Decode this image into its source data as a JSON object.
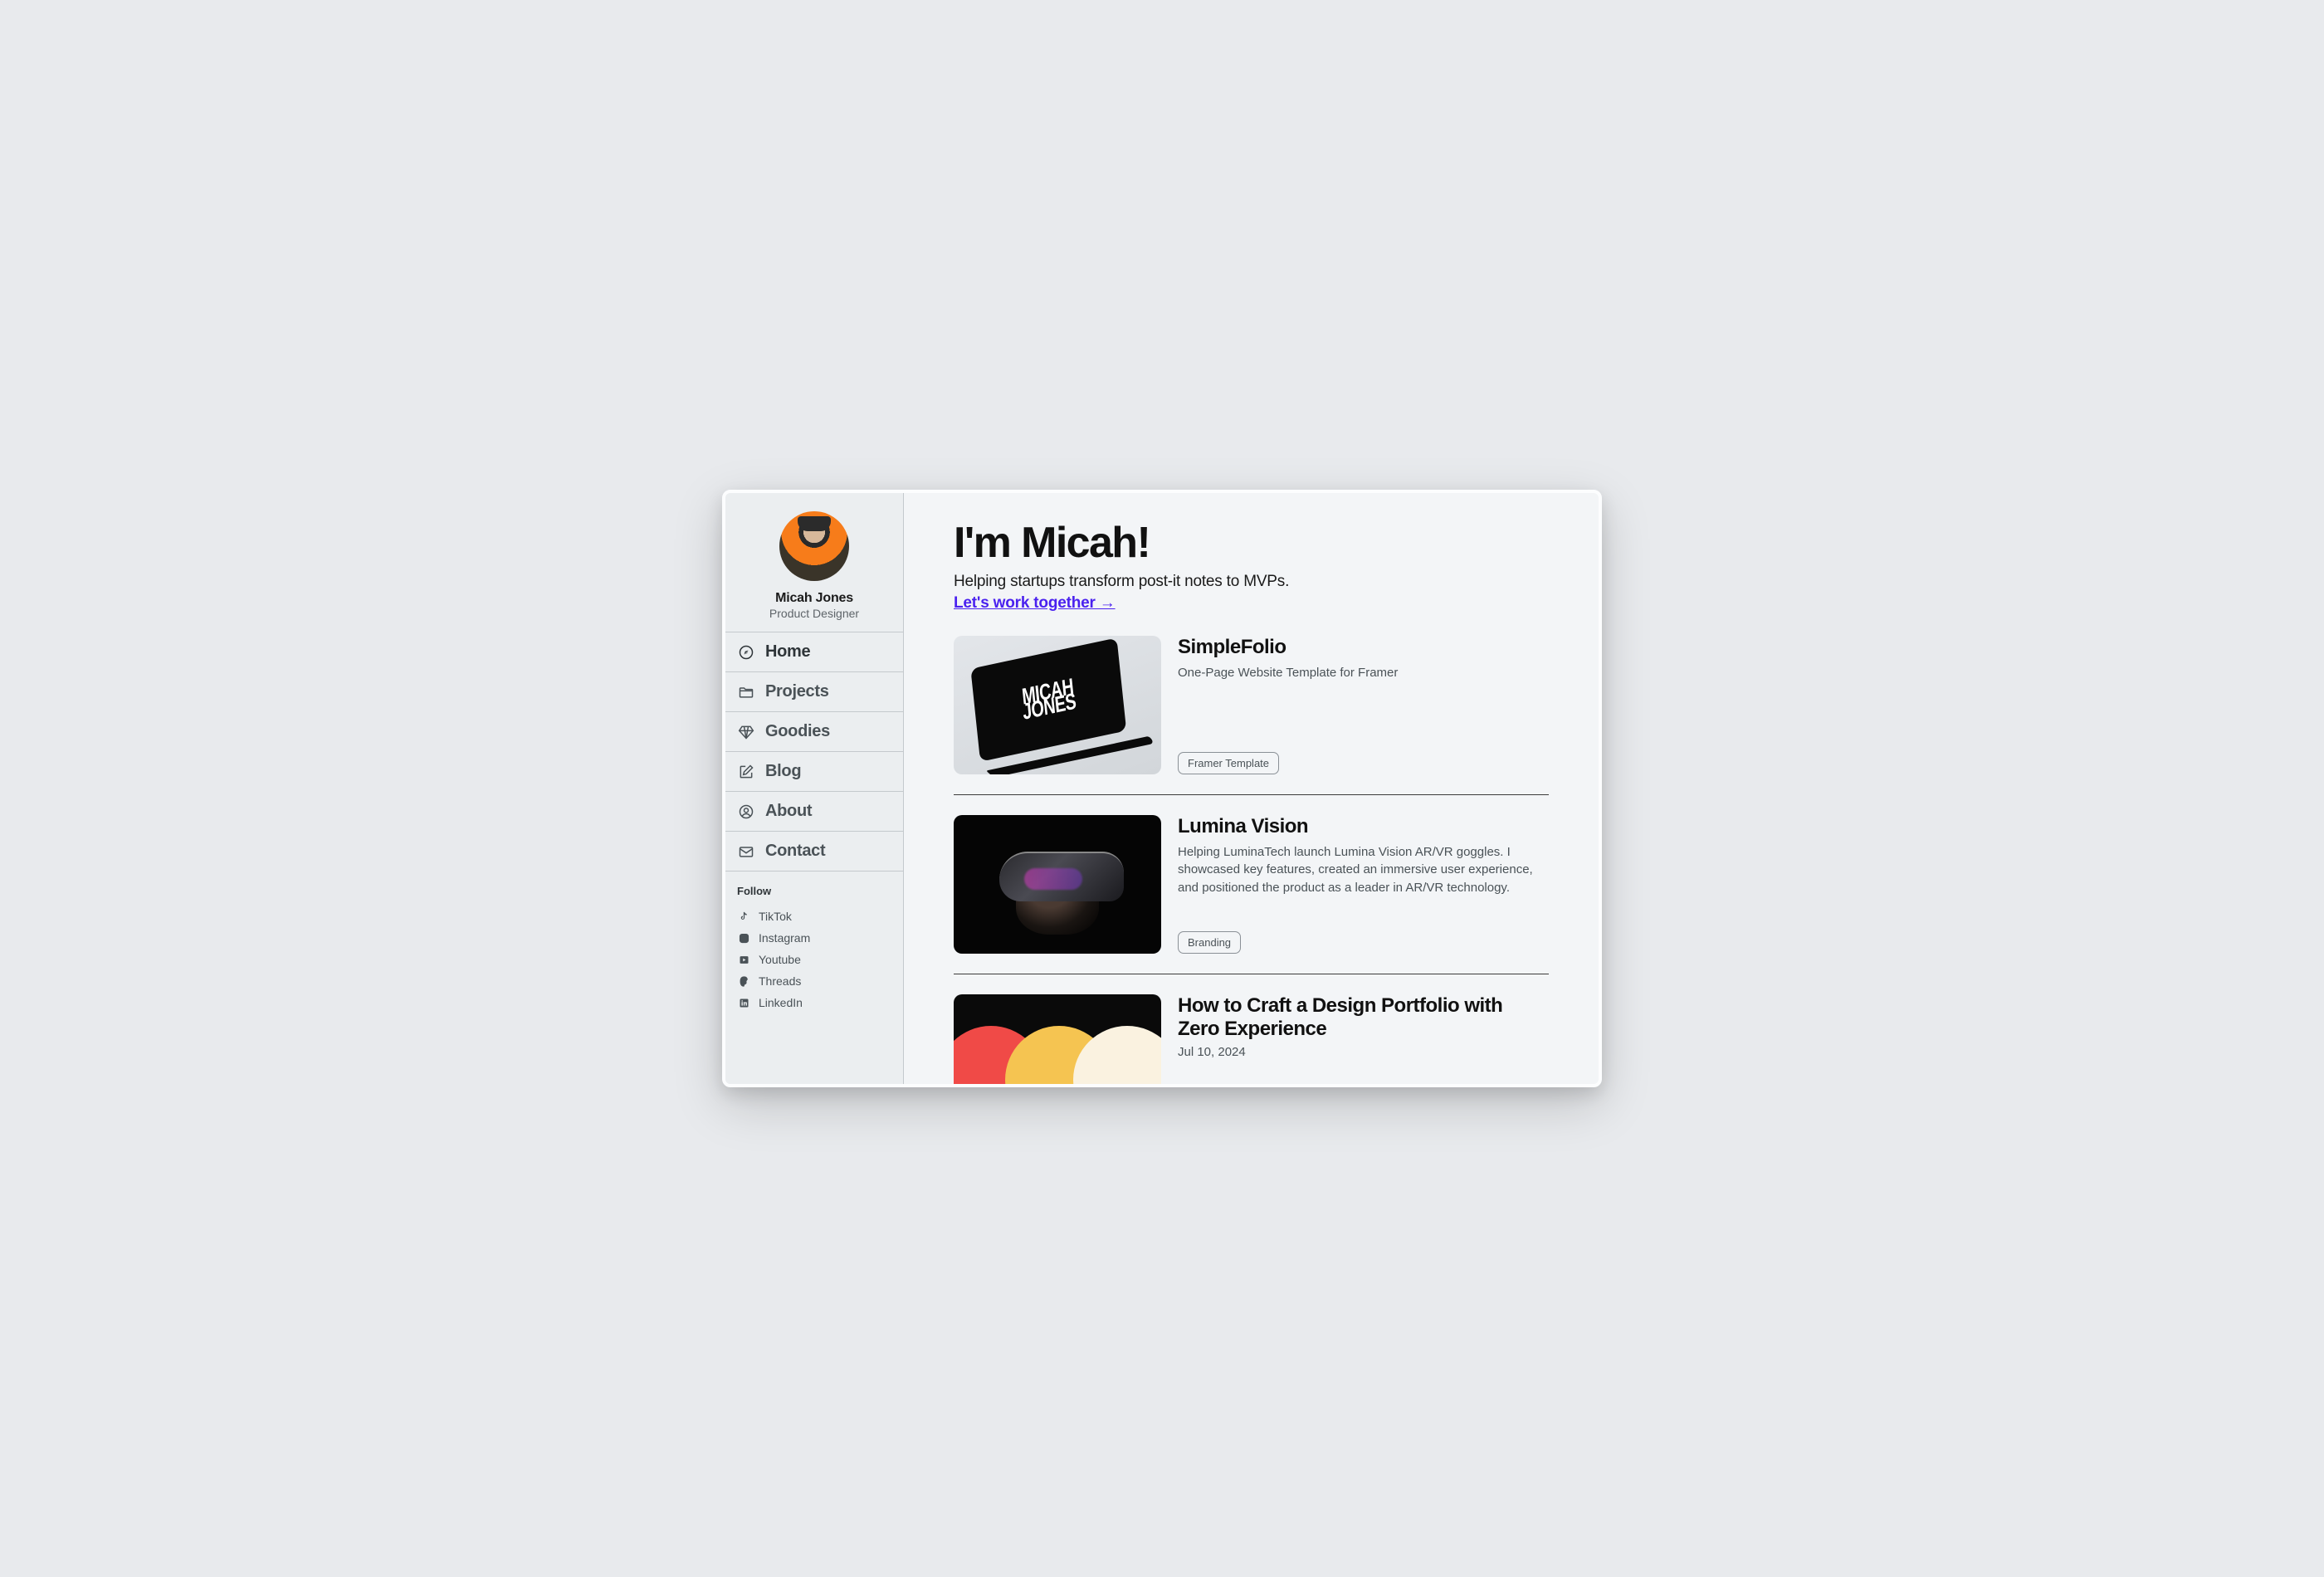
{
  "profile": {
    "name": "Micah Jones",
    "role": "Product Designer"
  },
  "nav": {
    "items": [
      {
        "icon": "compass-icon",
        "label": "Home"
      },
      {
        "icon": "folder-icon",
        "label": "Projects"
      },
      {
        "icon": "diamond-icon",
        "label": "Goodies"
      },
      {
        "icon": "edit-icon",
        "label": "Blog"
      },
      {
        "icon": "user-icon",
        "label": "About"
      },
      {
        "icon": "mail-icon",
        "label": "Contact"
      }
    ]
  },
  "follow": {
    "heading": "Follow",
    "items": [
      {
        "icon": "tiktok-icon",
        "label": "TikTok"
      },
      {
        "icon": "instagram-icon",
        "label": "Instagram"
      },
      {
        "icon": "youtube-icon",
        "label": "Youtube"
      },
      {
        "icon": "threads-icon",
        "label": "Threads"
      },
      {
        "icon": "linkedin-icon",
        "label": "LinkedIn"
      }
    ]
  },
  "hero": {
    "title": "I'm Micah!",
    "subtitle": "Helping startups transform post-it notes to MVPs.",
    "cta": "Let's work together →"
  },
  "cards": [
    {
      "title": "SimpleFolio",
      "description": "One-Page Website Template for Framer",
      "tag": "Framer Template",
      "thumb_text_line1": "MICAH",
      "thumb_text_line2": "JONES"
    },
    {
      "title": "Lumina Vision",
      "description": "Helping LuminaTech launch Lumina Vision AR/VR goggles. I showcased key features, created an immersive user experience, and positioned the product as a leader in AR/VR technology.",
      "tag": "Branding"
    },
    {
      "title": "How to Craft a Design Portfolio with Zero Experience",
      "date": "Jul 10, 2024"
    }
  ]
}
